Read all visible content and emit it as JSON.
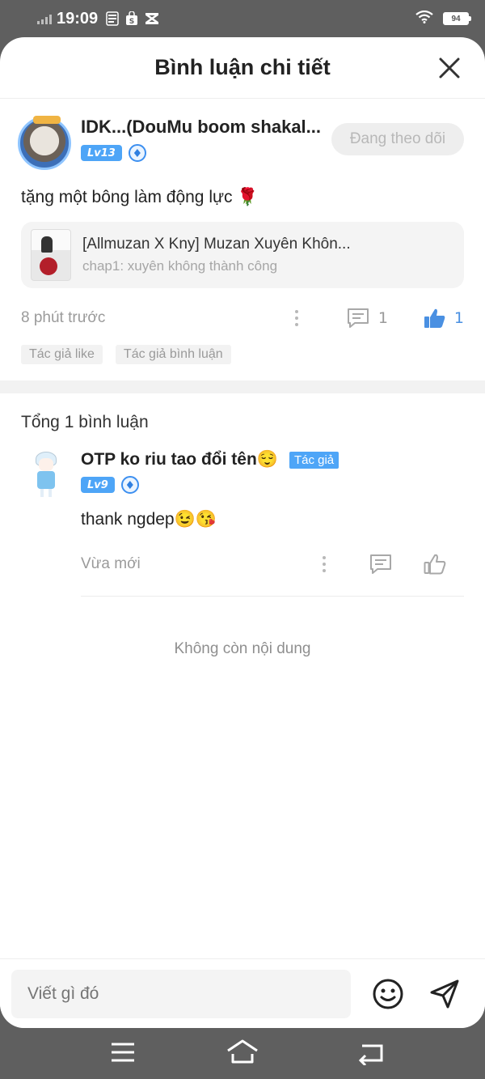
{
  "status_bar": {
    "time": "19:09",
    "notif_icons": [
      "news-icon",
      "shopee-icon",
      "capcut-icon"
    ],
    "battery_level": "94"
  },
  "header": {
    "title": "Bình luận chi tiết"
  },
  "main_comment": {
    "author_name": "IDK...(DouMu boom shakal...",
    "level": "Lv13",
    "follow_label": "Đang theo dõi",
    "text": "tặng một bông làm động lực",
    "emoji": "🌹",
    "story": {
      "title": "[Allmuzan X Kny] Muzan Xuyên Khôn...",
      "chapter": "chap1: xuyên không thành công"
    },
    "time": "8 phút trước",
    "reply_count": "1",
    "like_count": "1",
    "tags": [
      "Tác giả like",
      "Tác giả bình luận"
    ]
  },
  "replies_section": {
    "total_label": "Tổng 1 bình luận",
    "items": [
      {
        "author_name": "OTP ko riu tao đổi tên😌",
        "author_tag": "Tác giả",
        "level": "Lv9",
        "text": "thank ngdep😉😘",
        "time": "Vừa mới"
      }
    ],
    "end_label": "Không còn nội dung"
  },
  "input_bar": {
    "placeholder": "Viết gì đó"
  },
  "colors": {
    "accent": "#4ea5f7",
    "like": "#4a90e2",
    "system_bar": "#5f5f5f"
  }
}
